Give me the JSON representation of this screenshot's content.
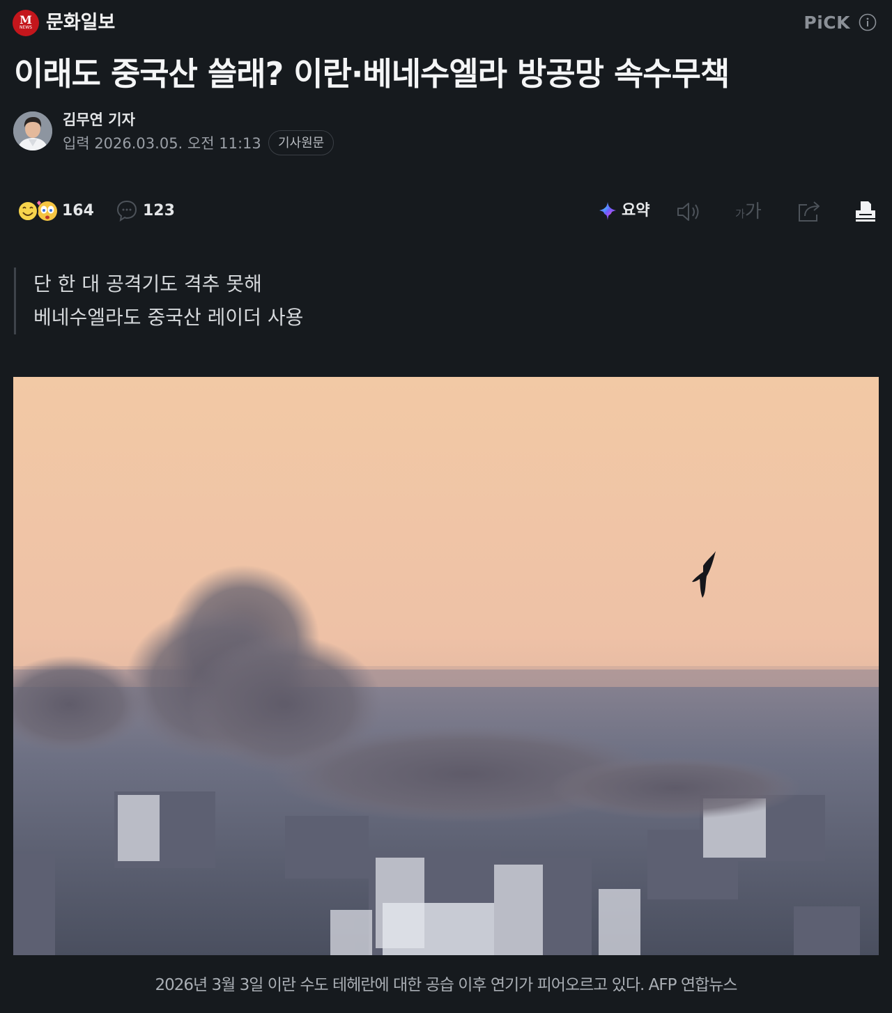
{
  "header": {
    "press_name": "문화일보",
    "logo_letter": "M",
    "logo_sub": "NEWS",
    "pick_label": "PiCK",
    "info_icon": "info-icon"
  },
  "article": {
    "headline": "이래도 중국산 쓸래? 이란·베네수엘라 방공망 속수무책",
    "author": "김무연 기자",
    "date": "입력 2026.03.05. 오전 11:13",
    "original_button": "기사원문",
    "subtitle_lines": [
      "단 한 대 공격기도 격추 못해",
      "베네수엘라도 중국산 레이더 사용"
    ],
    "photo_caption": "2026년 3월 3일 이란 수도 테헤란에 대한 공습 이후 연기가 피어오르고 있다. AFP 연합뉴스"
  },
  "toolbar": {
    "reaction_count": "164",
    "comment_count": "123",
    "summary_label": "요약",
    "font_size_glyph_small": "가",
    "font_size_glyph_large": "가",
    "icons": [
      "reaction-emoji-icon",
      "comment-icon",
      "summary-sparkle-icon",
      "speaker-icon",
      "font-size-icon",
      "share-icon",
      "print-icon"
    ]
  },
  "colors": {
    "background": "#161a1e",
    "logo_red": "#c4161c",
    "text_primary": "#f4f5f6",
    "text_muted": "#9a9fa6"
  }
}
